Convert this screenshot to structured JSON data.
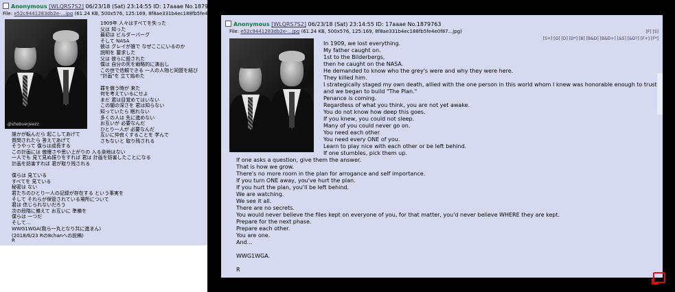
{
  "left": {
    "name": "Anonymous",
    "id_tag": "[WLQRS7S2]",
    "meta": "06/23/18 (Sat) 23:14:55 ID: 17aaae No.1879763",
    "file_prefix": "File:",
    "file_name": "e52c9441283db2e-...jpg",
    "file_info": "(61.24 KB, 500x576, 125:169, 8f8ae331b4ec188fb5fe4e0f87...",
    "watermark": "@shobuerjeezz",
    "text_right_of_image": "1909年 人々はすべてを失った\n父は 知った\n最初は ビルダーバーグ\nそして NASA\n彼は グレイが誰で なぜここにいるのか\n説明を 要求した\n父は 彼らに殺された\n僕は 自分の死を戦略的に演出し\nこの世で信頼できる 一人の人物と同盟を結び\n\"計画\"を 立て始めた\n\n罪を償う時が 来た\n何を考えているにせよ\nまだ 君は目覚めてはいない\nこの闇の深さを 君は知らない\n知っていたら 眠れない\n多くの人は 先に進めない\nお互いが 必要なんだ\nひとり一人が 必要なんだ\n互いに仲良くすることを 学んで\nさもないと 取り残される",
    "text_below_image": "誰かが転んだら 起こしてあげて\n質問されたら 答えてあげて\nそうやって 僕らは成長する\nこの計画には 傲慢さや思い上がりの 入る余地はない\n一人でも 見て見ぬ振りをすれば 君は 計画を妨害したことになる\n計画を妨害すれば 君が取り残される\n\n僕らは 見ている\nすべてを 見ている\n秘密は ない\n君たちのひとり一人の記録が存在する という事実を\nそして それらが保管されている場所について\n君は 信じられないだろう\n次の段階に備えて お互いに 準備を\n僕らは 一つだ\nそして...\nWWG1WGA(我ら一丸となり共に進まん)\n\nR",
    "footer": "(2018/6/23 Rの8chanへの投稿)"
  },
  "right": {
    "name": "Anonymous",
    "id_tag": "[WLQRS7S2]",
    "meta": "06/23/18 (Sat) 23:14:55 ID: 17aaae No.1879763",
    "file_prefix": "File:",
    "file_name": "e52c9441283db2e-...jpg",
    "file_info": "(61.24 KB, 500x576, 125:169, 8f8ae331b4ec188fb5fe4e0f87...jpg)",
    "nav_top": "[F] [S]",
    "nav_bottom": "[S+] [O] [D] [D*] [B] [B&D] [B&D+] [&S] [&D?] [F+] [F*]",
    "lines": [
      "In 1909, we lost everything.",
      "My father caught on.",
      "1st to the Bilderbergs,",
      "then he caught on the NASA.",
      "He demanded to know who the grey's were and why they were here.",
      "They killed him.",
      "I strategically staged my own death, allied with the one person in this world whom I knew was honorable enough to trust,",
      "and we began to build \"The Plan.\"",
      "Penance is coming.",
      "Regardless of what you think, you are not yet awake.",
      "You do not know how deep this goes.",
      "If you knew, you could not sleep.",
      "Many of you could never go on.",
      "You need each other.",
      "You need every ONE of you.",
      "Learn to play nice with each other or be left behind.",
      "If one stumbles, pick them up.",
      "If one asks a question, give them the answer.",
      "That is how we grow.",
      "There's no more room in the plan for arrogance and self importance.",
      "If you turn ONE away, you've hurt the plan.",
      "If you hurt the plan, you'll be left behind.",
      "We are watching.",
      "We see it all.",
      "There are no secrets.",
      "You would never believe the files kept on everyone of you, for that matter, you'd never believe WHERE they are kept.",
      "Prepare for the next phase.",
      "Prepare each other.",
      "You are one.",
      "And...",
      "",
      "WWG1WGA.",
      "",
      "R"
    ]
  },
  "colors": {
    "post_bg": "#d6daf0",
    "name_green": "#117743",
    "link_blue": "#34345c",
    "screen_bg": "#000000",
    "accent_red": "#dd1111"
  },
  "icons": [
    "checkbox-icon",
    "fullscreen-icon"
  ]
}
